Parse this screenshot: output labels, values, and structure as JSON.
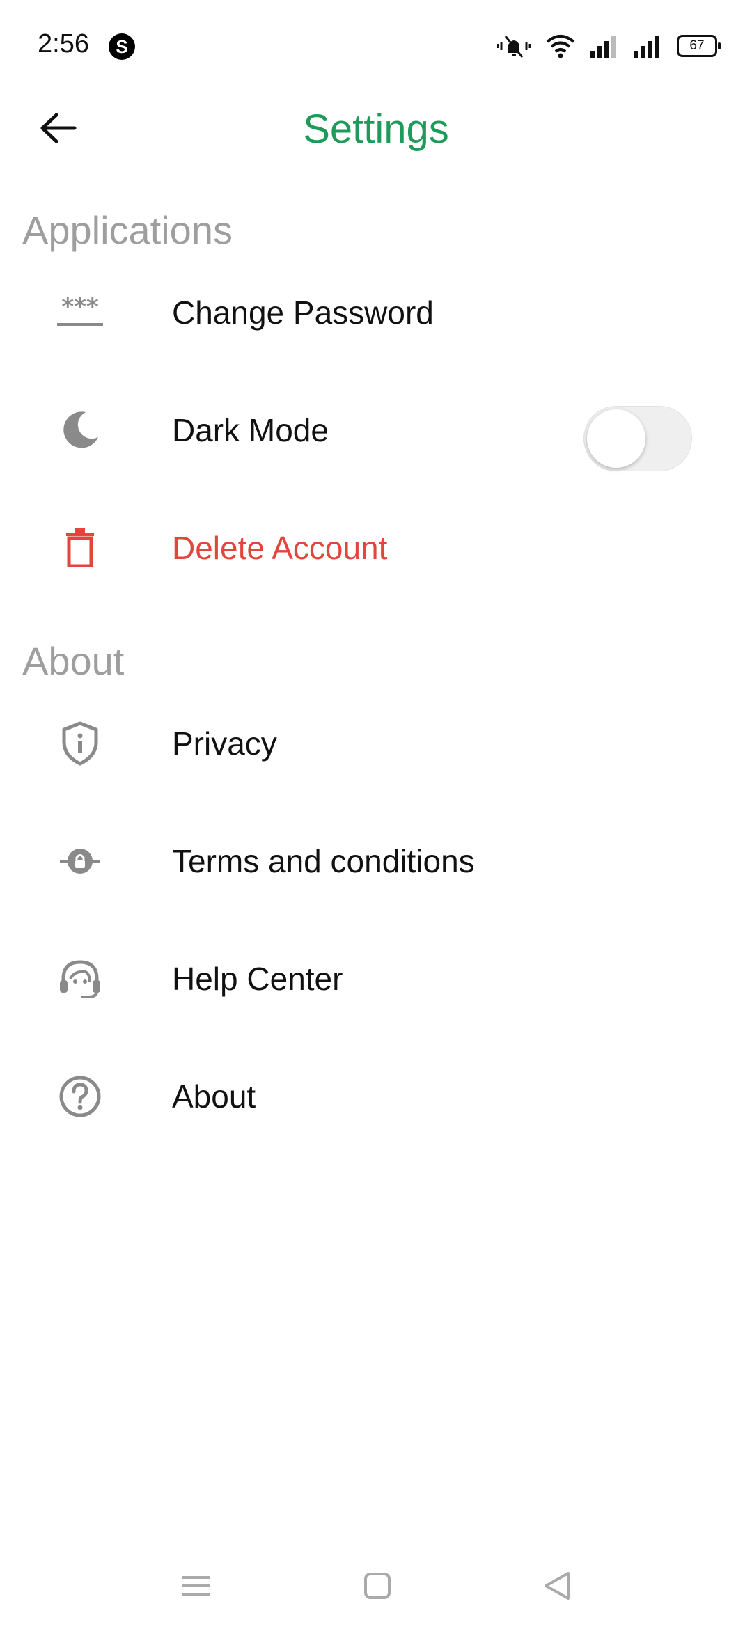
{
  "status_bar": {
    "time": "2:56",
    "app_icon_glyph": "S",
    "battery_level": "67",
    "icons": [
      "vibrate-icon",
      "wifi-icon",
      "signal-icon",
      "signal-icon"
    ]
  },
  "header": {
    "title": "Settings",
    "back_icon": "arrow-left-icon",
    "title_color": "#1e9b5b"
  },
  "sections": {
    "applications": {
      "title": "Applications",
      "items": {
        "change_password": {
          "label": "Change Password",
          "icon": "password-icon"
        },
        "dark_mode": {
          "label": "Dark Mode",
          "icon": "moon-icon",
          "toggle_on": false
        },
        "delete_account": {
          "label": "Delete Account",
          "icon": "trash-icon",
          "color": "#e2453b"
        }
      }
    },
    "about": {
      "title": "About",
      "items": {
        "privacy": {
          "label": "Privacy",
          "icon": "shield-info-icon"
        },
        "terms": {
          "label": "Terms and conditions",
          "icon": "lock-icon"
        },
        "help": {
          "label": "Help Center",
          "icon": "headset-icon"
        },
        "about": {
          "label": "About",
          "icon": "question-circle-icon"
        }
      }
    }
  },
  "nav_bar": {
    "buttons": [
      "menu-icon",
      "home-square-icon",
      "back-triangle-icon"
    ]
  }
}
